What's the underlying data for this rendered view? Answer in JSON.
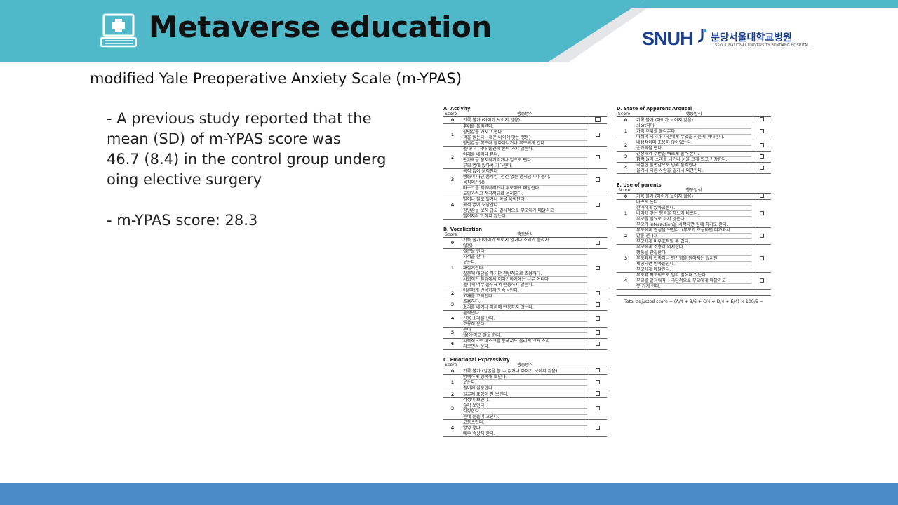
{
  "header": {
    "title": "Metaverse education",
    "logo_text": "SNUH",
    "logo_korean": "분당서울대학교병원",
    "logo_english": "SEOUL NATIONAL UNIVERSITY BUNDANG HOSPITAL",
    "colors": {
      "band": "#4fb9c9",
      "footer": "#4a8cc6",
      "logo": "#1b3f8f"
    }
  },
  "icons": {
    "title_icon": "medical-laptop-icon"
  },
  "subtitle": "modified Yale Preoperative Anxiety Scale (m-YPAS)",
  "bullets": {
    "b1_l1": "- A previous study reported that the",
    "b1_l2": "mean (SD) of m-YPAS score was",
    "b1_l3": "46.7 (8.4) in the control group underg",
    "b1_l4": "oing elective surgery",
    "b2": "- m-YPAS score: 28.3"
  },
  "scale": {
    "col_score": "Score",
    "col_behavior": "행동방식",
    "A": {
      "title": "A. Activity",
      "rows": [
        {
          "score": "0",
          "lines": [
            "기록 불가 (아이가 보이지 않음)"
          ]
        },
        {
          "score": "1",
          "lines": [
            "주위를 둘러본다.",
            "장난감을 가지고 논다.",
            "책을 읽는다. (혹은 나이에 맞는 행동)",
            "장난감을 찾으러 돌아다니거나 부모에게 간다"
          ]
        },
        {
          "score": "2",
          "lines": [
            "돌아다니거나 물건에 손이 가지 않는다.",
            "아래를 내려다 본다.",
            "손가락을 꼼지락거리거나 입으로 빤다.",
            "부모 옆에 앉아서 기다린다."
          ]
        },
        {
          "score": "3",
          "lines": [
            "목적 없이 움직인다",
            "행동이 아닌 움직임 (정신 없는 움직임이나 놀이,",
            "움직이거림)",
            "마스크를 치워버리거나 부모에게 매달린다."
          ]
        },
        {
          "score": "4",
          "lines": [
            "도망가려고 적극적으로 움직인다.",
            "발이나 팔로 밀거나 몸을 움직인다.",
            "목적 없이 도망간다.",
            "장난감을 보지 않고 필사적으로 부모에게 매달리고",
            "떨어지려고 하지 않는다."
          ]
        }
      ]
    },
    "B": {
      "title": "B. Vocalization",
      "rows": [
        {
          "score": "0",
          "lines": [
            "기록 불가 (아이가 보이지 않거나 소리가 들리지",
            "않음)"
          ]
        },
        {
          "score": "1",
          "lines": [
            "질문을 한다.",
            "지적을 한다.",
            "웃는다.",
            "재잘거린다.",
            "질문에 대답을 하지만 전반적으로 조용하다.",
            "사회적인 환경에서 이야기하기에는 너무 어리다.",
            "놀이에 너무 몰두해서 반응하지 않는다."
          ]
        },
        {
          "score": "2",
          "lines": [
            "어른에게 반응하지만 속삭인다.",
            "고개를 끄덕인다."
          ]
        },
        {
          "score": "3",
          "lines": [
            "조용하다.",
            "소리를 내거나 어른에 반응하지 않는다."
          ]
        },
        {
          "score": "4",
          "lines": [
            "훌쩍인다.",
            "신음 소리를 낸다.",
            "조용히 운다."
          ]
        },
        {
          "score": "5",
          "lines": [
            "운다",
            "'싫어'라고 말을 한다."
          ]
        },
        {
          "score": "6",
          "lines": [
            "지속적으로 마스크를 통해서도 들리게 크게 소리",
            "지르면서 운다."
          ]
        }
      ]
    },
    "C": {
      "title": "C. Emotional Expressivity",
      "rows": [
        {
          "score": "0",
          "lines": [
            "기록 불가 (얼굴을 볼 수 없거나 아이가 보이지 않음)"
          ]
        },
        {
          "score": "1",
          "lines": [
            "명백하게 행복해 보인다.",
            "웃는다.",
            "놀이에 집중한다."
          ]
        },
        {
          "score": "2",
          "lines": [
            "얼굴에 표정이 안 보인다."
          ]
        },
        {
          "score": "3",
          "lines": [
            "걱정이 보인다.",
            "슬퍼 보인다.",
            "걱정한다.",
            "눈에 눈물이 고인다."
          ]
        },
        {
          "score": "4",
          "lines": [
            "고통스럽다.",
            "엉엉 운다.",
            "매우 속상해 한다."
          ]
        }
      ]
    },
    "D": {
      "title": "D. State of Apparent Arousal",
      "rows": [
        {
          "score": "0",
          "lines": [
            "기록 불가 (아이가 보이지 않음)"
          ]
        },
        {
          "score": "1",
          "lines": [
            "alert하다.",
            "가끔 주위를 둘러본다.",
            "마취과 의사가 자신에게 무엇을 하는지 쳐다본다."
          ]
        },
        {
          "score": "2",
          "lines": [
            "내성적이며 조용히 앉아있는다.",
            "손가락을 빤다."
          ]
        },
        {
          "score": "3",
          "lines": [
            "긴장해서 주변을 빠르게 둘러 본다.",
            "깜짝 놀라 소리를 내거나 눈을 크게 뜨고 긴장한다."
          ]
        },
        {
          "score": "4",
          "lines": [
            "극심한 불편감으로 인해 훌쩍인다.",
            "울거나 다른 사람을 밀거나 외면한다."
          ]
        }
      ]
    },
    "E": {
      "title": "E. Use of parents",
      "rows": [
        {
          "score": "0",
          "lines": [
            "기록 불가 (아이가 보이지 않음)"
          ]
        },
        {
          "score": "1",
          "lines": [
            "바쁘게 논다.",
            "한가하게 앉아있는다.",
            "나이에 맞는 행동을 하느라 바쁘다.",
            "부모를 필요로 하지 않는다.",
            "부모가 interaction을 시작하면 함께 하기도 한다."
          ]
        },
        {
          "score": "2",
          "lines": [
            "부모에게 관심을 보인다. (부모가 조용하면 다가와서",
            "말을 건다.)",
            "부모에게 비우호적일 수 있다."
          ]
        },
        {
          "score": "3",
          "lines": [
            "부모에게 조용히 의지한다.",
            "행동을 관찰한다.",
            "부모와의 접촉이나 편안함을 원하지는 않지만",
            "제공되면 받아들인다.",
            "부모에게 매달린다."
          ]
        },
        {
          "score": "4",
          "lines": [
            "부모와 의도적으로 멀리 떨어져 있는다.",
            "부모를 밀쳐내거나 극단적으로 부모에게 매달리고",
            "못 가게 한다."
          ]
        }
      ]
    },
    "total": "Total adjusted score = (A/4 + B/6 + C/4 + D/4 + E/4) × 100/5 ="
  }
}
